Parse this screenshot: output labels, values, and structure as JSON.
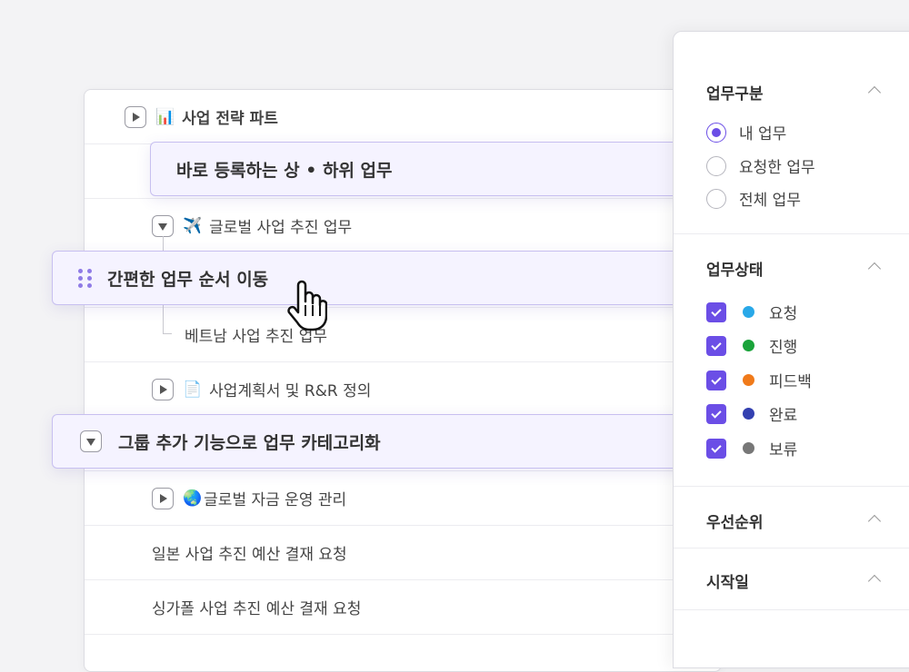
{
  "task_list": {
    "rows": [
      {
        "label": "사업 전략 파트",
        "icon": "bar-chart-emoji",
        "expanded": false
      },
      {
        "label": "글로벌 사업 추진 업무",
        "icon": "airplane-emoji",
        "expanded": true
      },
      {
        "label": "베트남 사업 추진 업무"
      },
      {
        "label": "사업계획서 및 R&R 정의",
        "icon": "document-emoji",
        "expanded": false
      },
      {
        "label": "글로벌 자금 운영 관리",
        "icon": "globe-emoji",
        "expanded": false
      },
      {
        "label": "일본 사업 추진 예산 결재 요청"
      },
      {
        "label": "싱가폴 사업 추진 예산 결재 요청"
      }
    ],
    "floating": {
      "quick_register": "바로 등록하는 상 • 하위 업무",
      "reorder": "간편한 업무 순서 이동",
      "categorize": "그룹 추가 기능으로 업무 카테고리화"
    }
  },
  "filter_panel": {
    "task_type": {
      "title": "업무구분",
      "options": [
        "내 업무",
        "요청한 업무",
        "전체 업무"
      ],
      "selected": "내 업무"
    },
    "task_status": {
      "title": "업무상태",
      "options": [
        {
          "label": "요청",
          "color": "#29a8e8",
          "checked": true
        },
        {
          "label": "진행",
          "color": "#1aa33a",
          "checked": true
        },
        {
          "label": "피드백",
          "color": "#f07a1a",
          "checked": true
        },
        {
          "label": "완료",
          "color": "#3340b0",
          "checked": true
        },
        {
          "label": "보류",
          "color": "#777777",
          "checked": true
        }
      ]
    },
    "priority": {
      "title": "우선순위"
    },
    "start_date": {
      "title": "시작일"
    }
  },
  "colors": {
    "accent": "#6b4ee6",
    "floating_bg": "#f5f3ff"
  }
}
